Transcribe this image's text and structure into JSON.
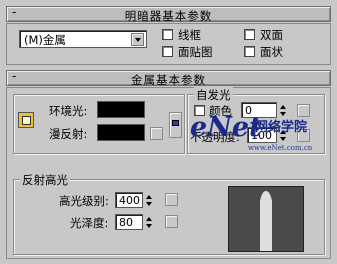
{
  "shader": {
    "title": "明暗器基本参数",
    "dropdown_value": "(M)金属",
    "wire_label": "线框",
    "two_sided_label": "双面",
    "face_map_label": "面贴图",
    "faceted_label": "面状"
  },
  "metal": {
    "title": "金属基本参数",
    "ambient_label": "环境光:",
    "diffuse_label": "漫反射:",
    "self_illum": {
      "title": "自发光",
      "color_label": "颜色",
      "color_value": "0"
    },
    "opacity_label": "不透明度:",
    "opacity_value": "100",
    "specular": {
      "title": "反射高光",
      "level_label": "高光级别:",
      "level_value": "400",
      "gloss_label": "光泽度:",
      "gloss_value": "80"
    }
  },
  "watermark": {
    "main": "eNet",
    "sub": "网络学院",
    "url": "www.eNet.com.cn"
  },
  "colors": {
    "panel_bg": "#c8c8c8",
    "swatch": "#000000",
    "lock_icon": "#e8c23a",
    "watermark": "#1b2a8a"
  }
}
